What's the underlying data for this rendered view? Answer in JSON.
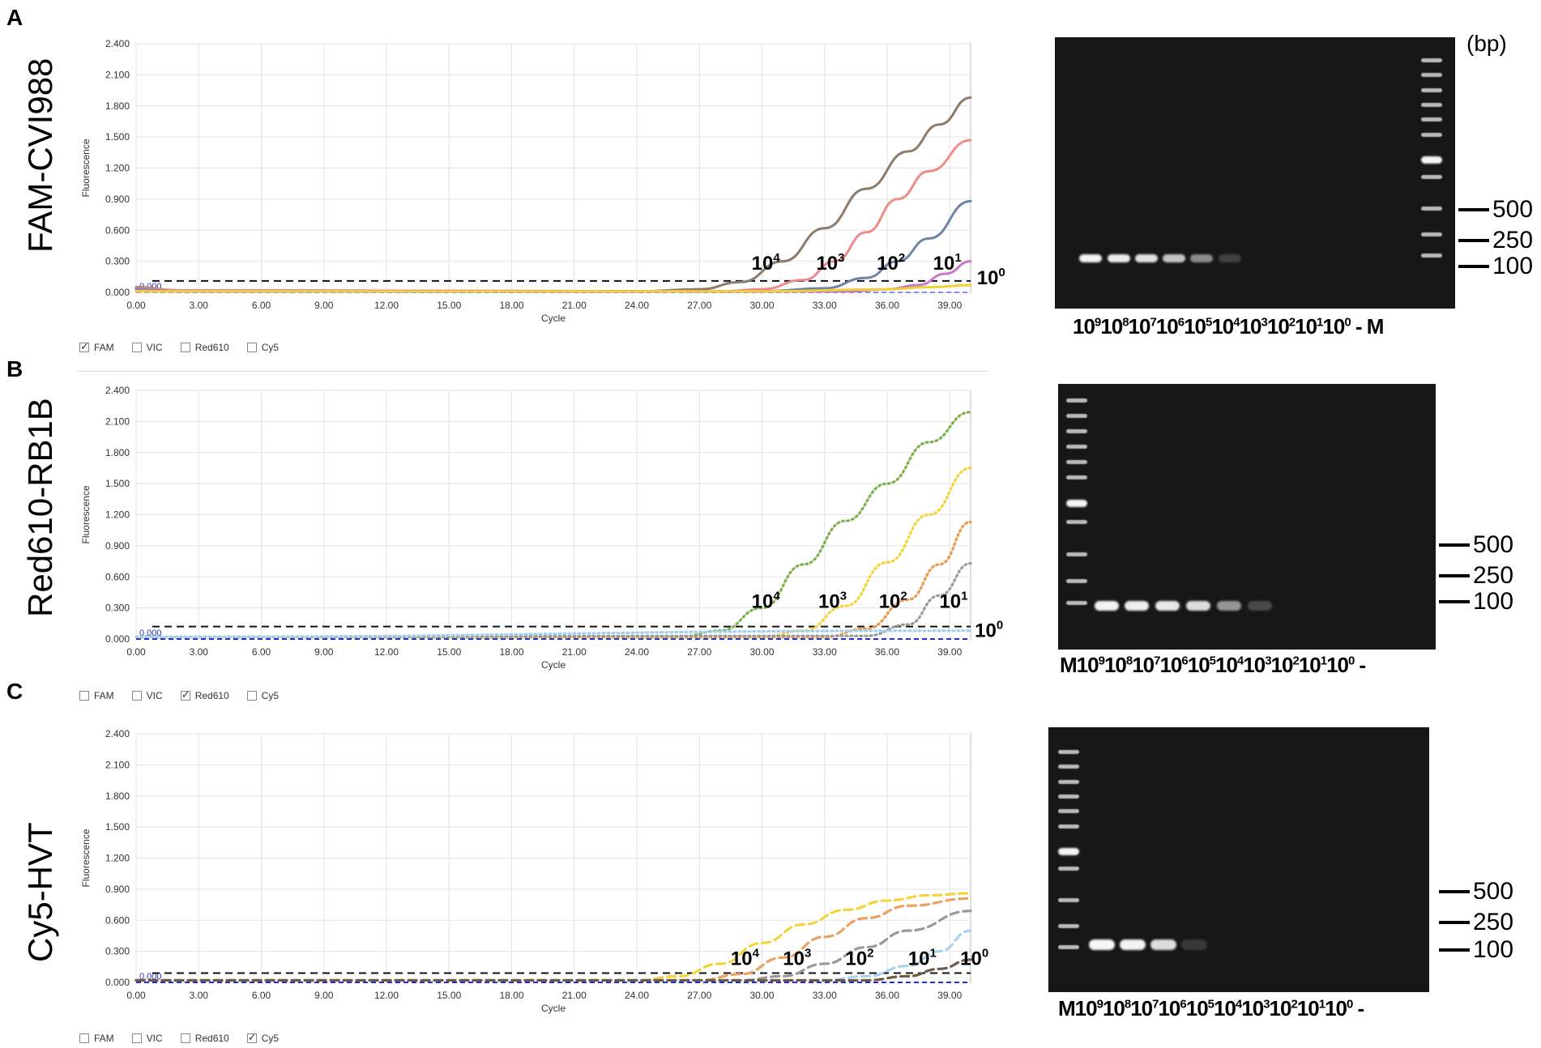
{
  "panels": [
    {
      "letter": "A",
      "title": "FAM-CVI988",
      "ylabel": "Fluorescence",
      "xlabel": "Cycle",
      "threshold_label": "0.000",
      "legend": [
        {
          "label": "FAM",
          "checked": true
        },
        {
          "label": "VIC",
          "checked": false
        },
        {
          "label": "Red610",
          "checked": false
        },
        {
          "label": "Cy5",
          "checked": false
        }
      ],
      "gel_labels": [
        "10",
        "9",
        "10",
        "8",
        "10",
        "7",
        "10",
        "6",
        "10",
        "5",
        "10",
        "4",
        "10",
        "3",
        "10",
        "2",
        "10",
        "1",
        "10",
        "0",
        " - ",
        "M"
      ],
      "gel_bp_unit": "(bp)",
      "gel_markers": [
        "500",
        "250",
        "100"
      ]
    },
    {
      "letter": "B",
      "title": "Red610-RB1B",
      "ylabel": "Fluorescence",
      "xlabel": "Cycle",
      "threshold_label": "0.000",
      "legend": [
        {
          "label": "FAM",
          "checked": false
        },
        {
          "label": "VIC",
          "checked": false
        },
        {
          "label": "Red610",
          "checked": true
        },
        {
          "label": "Cy5",
          "checked": false
        }
      ],
      "gel_labels": [
        "M",
        "10",
        "9",
        "10",
        "8",
        "10",
        "7",
        "10",
        "6",
        "10",
        "5",
        "10",
        "4",
        "10",
        "3",
        "10",
        "2",
        "10",
        "1",
        "10",
        "0",
        " -"
      ],
      "gel_markers": [
        "500",
        "250",
        "100"
      ]
    },
    {
      "letter": "C",
      "title": "Cy5-HVT",
      "ylabel": "Fluorescence",
      "xlabel": "Cycle",
      "threshold_label": "0.000",
      "legend": [
        {
          "label": "FAM",
          "checked": false
        },
        {
          "label": "VIC",
          "checked": false
        },
        {
          "label": "Red610",
          "checked": false
        },
        {
          "label": "Cy5",
          "checked": true
        }
      ],
      "gel_labels": [
        "M",
        "10",
        "9",
        "10",
        "8",
        "10",
        "7",
        "10",
        "6",
        "10",
        "5",
        "10",
        "4",
        "10",
        "3",
        "10",
        "2",
        "10",
        "1",
        "10",
        "0",
        " -"
      ],
      "gel_markers": [
        "500",
        "250",
        "100"
      ]
    }
  ],
  "chart_data": [
    {
      "type": "line",
      "panel": "A",
      "style": "solid",
      "xlabel": "Cycle",
      "ylabel": "Fluorescence",
      "xlim": [
        0,
        40
      ],
      "ylim": [
        0,
        2.4
      ],
      "xticks": [
        "0.00",
        "3.00",
        "6.00",
        "9.00",
        "12.00",
        "15.00",
        "18.00",
        "21.00",
        "24.00",
        "27.00",
        "30.00",
        "33.00",
        "36.00",
        "39.00"
      ],
      "yticks": [
        "0.000",
        "0.300",
        "0.600",
        "0.900",
        "1.200",
        "1.500",
        "1.800",
        "2.100",
        "2.400"
      ],
      "threshold": 0.11,
      "baseline": 0.0,
      "series": [
        {
          "label": "10⁴",
          "color": "#8c7a6b",
          "values": [
            [
              0,
              0.05
            ],
            [
              2,
              0.02
            ],
            [
              24,
              0.01
            ],
            [
              27,
              0.03
            ],
            [
              29,
              0.1
            ],
            [
              31,
              0.3
            ],
            [
              33,
              0.62
            ],
            [
              35,
              1.0
            ],
            [
              37,
              1.36
            ],
            [
              38.5,
              1.62
            ],
            [
              40,
              1.88
            ]
          ]
        },
        {
          "label": "10³",
          "color": "#f08a8a",
          "values": [
            [
              0,
              0.04
            ],
            [
              2,
              0.02
            ],
            [
              28,
              0.01
            ],
            [
              30,
              0.03
            ],
            [
              32,
              0.12
            ],
            [
              33.5,
              0.3
            ],
            [
              35,
              0.58
            ],
            [
              36.5,
              0.9
            ],
            [
              38,
              1.17
            ],
            [
              40,
              1.47
            ]
          ]
        },
        {
          "label": "10²",
          "color": "#6d83a8",
          "values": [
            [
              0,
              0.03
            ],
            [
              2,
              0.01
            ],
            [
              30,
              0.01
            ],
            [
              33,
              0.04
            ],
            [
              35,
              0.14
            ],
            [
              36.5,
              0.3
            ],
            [
              38,
              0.52
            ],
            [
              40,
              0.88
            ]
          ]
        },
        {
          "label": "10¹",
          "color": "#c878c8",
          "values": [
            [
              0,
              0.02
            ],
            [
              2,
              0.01
            ],
            [
              34,
              0.01
            ],
            [
              36,
              0.03
            ],
            [
              37.5,
              0.07
            ],
            [
              38.8,
              0.18
            ],
            [
              40,
              0.3
            ]
          ]
        },
        {
          "label": "10⁰",
          "color": "#f2d035",
          "values": [
            [
              0,
              0.01
            ],
            [
              30,
              0.01
            ],
            [
              36,
              0.03
            ],
            [
              38,
              0.05
            ],
            [
              40,
              0.07
            ]
          ]
        }
      ],
      "annotations": [
        {
          "text": "10",
          "sup": "4",
          "x": 29.5,
          "y": 0.22
        },
        {
          "text": "10",
          "sup": "3",
          "x": 32.6,
          "y": 0.22
        },
        {
          "text": "10",
          "sup": "2",
          "x": 35.5,
          "y": 0.22
        },
        {
          "text": "10",
          "sup": "1",
          "x": 38.2,
          "y": 0.22
        },
        {
          "text": "10",
          "sup": "0",
          "x": 40.3,
          "y": 0.08
        }
      ]
    },
    {
      "type": "line",
      "panel": "B",
      "style": "dotted",
      "xlabel": "Cycle",
      "ylabel": "Fluorescence",
      "xlim": [
        0,
        40
      ],
      "ylim": [
        0,
        2.4
      ],
      "xticks": [
        "0.00",
        "3.00",
        "6.00",
        "9.00",
        "12.00",
        "15.00",
        "18.00",
        "21.00",
        "24.00",
        "27.00",
        "30.00",
        "33.00",
        "36.00",
        "39.00"
      ],
      "yticks": [
        "0.000",
        "0.300",
        "0.600",
        "0.900",
        "1.200",
        "1.500",
        "1.800",
        "2.100",
        "2.400"
      ],
      "threshold": 0.12,
      "baseline": 0.0,
      "series": [
        {
          "label": "10⁴",
          "color": "#7fb04f",
          "values": [
            [
              0,
              0.02
            ],
            [
              26,
              0.02
            ],
            [
              28,
              0.08
            ],
            [
              30,
              0.3
            ],
            [
              32,
              0.72
            ],
            [
              34,
              1.14
            ],
            [
              36,
              1.5
            ],
            [
              38,
              1.9
            ],
            [
              40,
              2.19
            ]
          ]
        },
        {
          "label": "10³",
          "color": "#f5d33a",
          "values": [
            [
              0,
              0.02
            ],
            [
              30,
              0.02
            ],
            [
              32,
              0.08
            ],
            [
              34,
              0.32
            ],
            [
              36,
              0.74
            ],
            [
              38,
              1.2
            ],
            [
              40,
              1.65
            ]
          ]
        },
        {
          "label": "10²",
          "color": "#eb9a4e",
          "values": [
            [
              0,
              0.02
            ],
            [
              33,
              0.02
            ],
            [
              35,
              0.1
            ],
            [
              37,
              0.38
            ],
            [
              38.5,
              0.72
            ],
            [
              40,
              1.13
            ]
          ]
        },
        {
          "label": "10¹",
          "color": "#9a9a9a",
          "values": [
            [
              0,
              0.02
            ],
            [
              35,
              0.03
            ],
            [
              37,
              0.14
            ],
            [
              38.5,
              0.42
            ],
            [
              40,
              0.73
            ]
          ]
        },
        {
          "label": "10⁰",
          "color": "#9fd0ef",
          "values": [
            [
              0,
              0.02
            ],
            [
              40,
              0.08
            ]
          ]
        }
      ],
      "annotations": [
        {
          "text": "10",
          "sup": "4",
          "x": 29.5,
          "y": 0.3
        },
        {
          "text": "10",
          "sup": "3",
          "x": 32.7,
          "y": 0.3
        },
        {
          "text": "10",
          "sup": "2",
          "x": 35.6,
          "y": 0.3
        },
        {
          "text": "10",
          "sup": "1",
          "x": 38.5,
          "y": 0.3
        },
        {
          "text": "10",
          "sup": "0",
          "x": 40.2,
          "y": 0.02
        }
      ]
    },
    {
      "type": "line",
      "panel": "C",
      "style": "dashed",
      "xlabel": "Cycle",
      "ylabel": "Fluorescence",
      "xlim": [
        0,
        40
      ],
      "ylim": [
        0,
        2.4
      ],
      "xticks": [
        "0.00",
        "3.00",
        "6.00",
        "9.00",
        "12.00",
        "15.00",
        "18.00",
        "21.00",
        "24.00",
        "27.00",
        "30.00",
        "33.00",
        "36.00",
        "39.00"
      ],
      "yticks": [
        "0.000",
        "0.300",
        "0.600",
        "0.900",
        "1.200",
        "1.500",
        "1.800",
        "2.100",
        "2.400"
      ],
      "threshold": 0.09,
      "baseline": 0.0,
      "series": [
        {
          "label": "10⁴",
          "color": "#f4d33c",
          "values": [
            [
              0,
              0.02
            ],
            [
              24,
              0.02
            ],
            [
              26,
              0.06
            ],
            [
              28,
              0.18
            ],
            [
              30,
              0.38
            ],
            [
              32,
              0.56
            ],
            [
              34,
              0.7
            ],
            [
              36,
              0.79
            ],
            [
              38,
              0.84
            ],
            [
              40,
              0.86
            ]
          ]
        },
        {
          "label": "10³",
          "color": "#eba261",
          "values": [
            [
              0,
              0.02
            ],
            [
              27,
              0.02
            ],
            [
              29,
              0.08
            ],
            [
              31,
              0.24
            ],
            [
              33,
              0.44
            ],
            [
              35,
              0.62
            ],
            [
              37,
              0.74
            ],
            [
              40,
              0.81
            ]
          ]
        },
        {
          "label": "10²",
          "color": "#999999",
          "values": [
            [
              0,
              0.02
            ],
            [
              29,
              0.02
            ],
            [
              31,
              0.06
            ],
            [
              33,
              0.18
            ],
            [
              35,
              0.34
            ],
            [
              37,
              0.5
            ],
            [
              40,
              0.69
            ]
          ]
        },
        {
          "label": "10¹",
          "color": "#a8d3ee",
          "values": [
            [
              0,
              0.02
            ],
            [
              33,
              0.02
            ],
            [
              35,
              0.06
            ],
            [
              37,
              0.16
            ],
            [
              38.5,
              0.3
            ],
            [
              40,
              0.5
            ]
          ]
        },
        {
          "label": "10⁰",
          "color": "#6e5a4b",
          "values": [
            [
              0,
              0.02
            ],
            [
              35,
              0.02
            ],
            [
              37,
              0.06
            ],
            [
              38.5,
              0.13
            ],
            [
              40,
              0.22
            ]
          ]
        }
      ],
      "annotations": [
        {
          "text": "10",
          "sup": "4",
          "x": 28.5,
          "y": 0.17
        },
        {
          "text": "10",
          "sup": "3",
          "x": 31.0,
          "y": 0.17
        },
        {
          "text": "10",
          "sup": "2",
          "x": 34.0,
          "y": 0.17
        },
        {
          "text": "10",
          "sup": "1",
          "x": 37.0,
          "y": 0.17
        },
        {
          "text": "10",
          "sup": "0",
          "x": 39.5,
          "y": 0.17
        }
      ]
    }
  ]
}
